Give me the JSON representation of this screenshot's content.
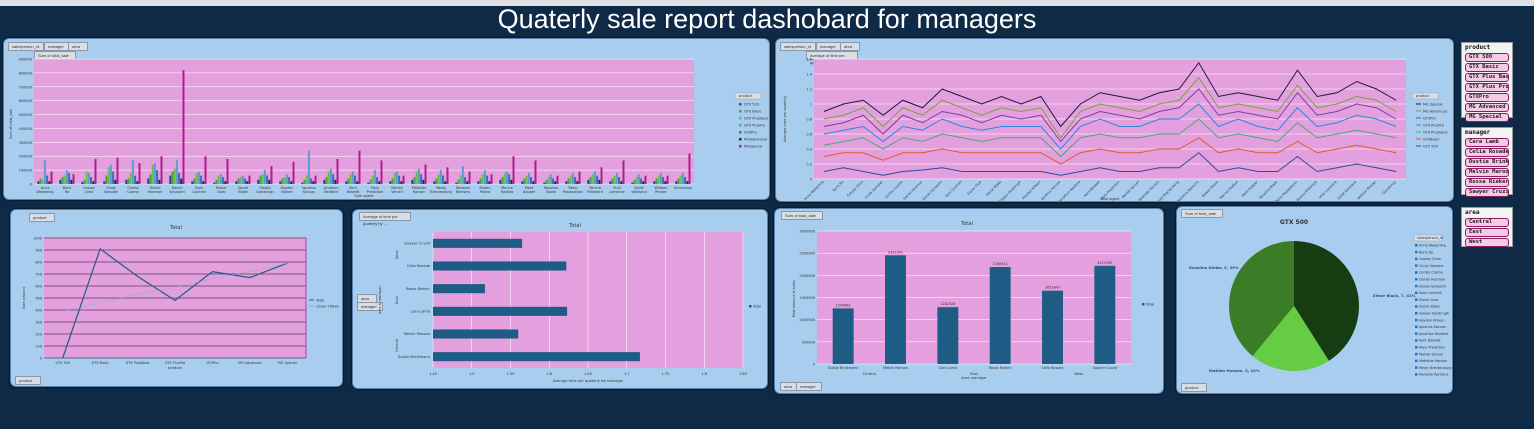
{
  "page_title": "Quaterly sale report dashobard for managers",
  "filters": {
    "salesperson": "salesperson_rd",
    "manager": "manager",
    "area": "area",
    "product": "product",
    "sum_total_sale": "Sum of total_sale",
    "avg_time": "Average of time per quaterly by ...",
    "sum_pie": "Sum of total_sale"
  },
  "slicers": {
    "product": {
      "title": "product",
      "items": [
        "GTX 500",
        "GTX Basic",
        "GTX Plus Basic",
        "GTX Plus Pro",
        "GTXPro",
        "MG Advanced",
        "MG Special"
      ]
    },
    "manager": {
      "title": "manager",
      "items": [
        "Cara Lamb",
        "Celia Rosade",
        "Dustie Brinkm...",
        "Melvin Maroon",
        "Rossa Riekerl",
        "Sawyer Cruzid"
      ]
    },
    "area": {
      "title": "area",
      "items": [
        "Central",
        "East",
        "West"
      ]
    }
  },
  "chart_data": [
    {
      "id": "chart1",
      "type": "bar",
      "title": "",
      "xlabel": "Sale agent",
      "ylabel": "Sum of total_sale",
      "ylim": [
        0,
        900000
      ],
      "yticks": [
        "0",
        "100000",
        "200000",
        "300000",
        "400000",
        "500000",
        "600000",
        "700000",
        "800000",
        "900000"
      ],
      "legend_title": "product",
      "categories": [
        "Anna Weberling",
        "Boris Ra",
        "Cassey Cima",
        "Cindy Sampler",
        "Corliss Cosme",
        "Daniel Hoeman",
        "Daniel Schaachi",
        "Dom Cockrell",
        "Eloise Clow",
        "Darrel Blake",
        "Gladys Golsbrugh",
        "Hayden Killeen",
        "Ignatius Kacvas",
        "Jonathan Bedford",
        "Kent Blewett",
        "Mary Prediction",
        "Mariah Vercell",
        "Mathilde Hanson",
        "Mealy Breckenburg",
        "Nanaine Ramsins",
        "Rowen Paseo",
        "Marina Hadlow",
        "Meet Dapper",
        "Rosalina Blade",
        "Retro Pepapolysis",
        "Verena Pilliehard",
        "Vicki Lamence",
        "Violet Wickland",
        "Willison Pender",
        "Danelonay"
      ],
      "series": [
        {
          "name": "GTX 500",
          "color": "#1f4e79",
          "values": [
            20000,
            30000,
            15000,
            20000,
            30000,
            40000,
            60000,
            20000,
            10000,
            20000,
            30000,
            20000,
            10000,
            30000,
            20000,
            10000,
            20000,
            30000,
            20000,
            10000,
            20000,
            30000,
            20000,
            10000,
            20000,
            30000,
            20000,
            10000,
            20000,
            20000
          ]
        },
        {
          "name": "GTX Basic",
          "color": "#4e9b4e",
          "values": [
            40000,
            50000,
            30000,
            60000,
            40000,
            70000,
            90000,
            40000,
            30000,
            40000,
            60000,
            40000,
            30000,
            50000,
            40000,
            30000,
            40000,
            50000,
            40000,
            30000,
            40000,
            50000,
            40000,
            30000,
            40000,
            50000,
            40000,
            30000,
            40000,
            40000
          ]
        },
        {
          "name": "GTX PlusBasic",
          "color": "#6fbf3f",
          "values": [
            30000,
            60000,
            90000,
            120000,
            80000,
            140000,
            110000,
            80000,
            60000,
            50000,
            70000,
            50000,
            60000,
            90000,
            70000,
            60000,
            80000,
            90000,
            70000,
            60000,
            70000,
            80000,
            60000,
            50000,
            60000,
            70000,
            60000,
            50000,
            60000,
            60000
          ]
        },
        {
          "name": "GTX PlusPro",
          "color": "#5b9bd5",
          "values": [
            170000,
            100000,
            80000,
            140000,
            170000,
            150000,
            170000,
            90000,
            70000,
            60000,
            100000,
            70000,
            240000,
            110000,
            90000,
            100000,
            90000,
            110000,
            100000,
            130000,
            100000,
            90000,
            80000,
            70000,
            80000,
            90000,
            80000,
            70000,
            80000,
            80000
          ]
        },
        {
          "name": "GTXPro",
          "color": "#2e75b6",
          "values": [
            60000,
            80000,
            50000,
            90000,
            60000,
            100000,
            80000,
            60000,
            50000,
            40000,
            60000,
            50000,
            40000,
            70000,
            60000,
            50000,
            60000,
            70000,
            60000,
            50000,
            60000,
            70000,
            50000,
            40000,
            50000,
            60000,
            50000,
            40000,
            50000,
            50000
          ]
        },
        {
          "name": "MGAdvanced",
          "color": "#1c2b5a",
          "values": [
            20000,
            30000,
            20000,
            30000,
            20000,
            30000,
            40000,
            20000,
            20000,
            20000,
            30000,
            20000,
            20000,
            30000,
            20000,
            20000,
            20000,
            30000,
            20000,
            20000,
            20000,
            30000,
            20000,
            20000,
            20000,
            30000,
            20000,
            20000,
            20000,
            20000
          ]
        },
        {
          "name": "MGSpecial",
          "color": "#b01b8e",
          "values": [
            90000,
            70000,
            180000,
            190000,
            150000,
            200000,
            820000,
            200000,
            180000,
            60000,
            130000,
            160000,
            60000,
            180000,
            240000,
            170000,
            60000,
            140000,
            120000,
            90000,
            70000,
            200000,
            170000,
            60000,
            90000,
            120000,
            170000,
            60000,
            60000,
            220000
          ]
        }
      ]
    },
    {
      "id": "chart2",
      "type": "line",
      "title": "",
      "xlabel": "Sale agent",
      "ylabel": "Average time per quaterly",
      "ylim": [
        0,
        1.6
      ],
      "yticks": [
        "0",
        "0.2",
        "0.4",
        "0.6",
        "0.8",
        "1",
        "1.2",
        "1.4",
        "1.6"
      ],
      "legend_title": "product",
      "categories": [
        "Anna Weberling",
        "Boris Ra",
        "Cassey Cima",
        "Cindy Sampler",
        "Corliss Cosme",
        "Daniel Hoeman",
        "Daniel Schaachi",
        "Dom Cockrell",
        "Eloise Clow",
        "Darrel Blake",
        "Gladys Golsbrugh",
        "Hayden Killeen",
        "Ignatius Kacvas",
        "Jonathan Bedford",
        "Kent Blewett",
        "Mary Prediction",
        "Mariah Vercell",
        "Mathilde Hanson",
        "Mealy Breckenburg",
        "Nanaine Ramsins",
        "Rowen Paseo",
        "Marina Hadlow",
        "Meet Dapper",
        "Rosalina Blade",
        "Retro Pepapolysis",
        "Verena Pilliehard",
        "Vicki Lamence",
        "Violet Wickland",
        "Willison Pender",
        "Danelonay"
      ],
      "series": [
        {
          "name": "MG Special",
          "color": "#1c1c3c",
          "values": [
            0.9,
            1.0,
            1.05,
            0.85,
            1.05,
            0.95,
            1.2,
            1.1,
            1.0,
            1.1,
            1.0,
            1.1,
            0.7,
            1.0,
            1.15,
            1.1,
            1.05,
            1.15,
            1.2,
            1.55,
            1.1,
            1.15,
            1.1,
            1.05,
            1.45,
            1.1,
            1.15,
            1.3,
            1.2,
            1.05
          ]
        },
        {
          "name": "MG Advanced",
          "color": "#7aa23c",
          "values": [
            0.8,
            0.85,
            0.95,
            0.7,
            0.95,
            0.85,
            1.05,
            0.95,
            0.85,
            0.95,
            0.9,
            0.95,
            0.55,
            0.9,
            1.0,
            0.95,
            0.9,
            1.0,
            1.05,
            1.35,
            0.95,
            1.0,
            0.95,
            0.9,
            1.25,
            0.95,
            1.0,
            1.1,
            1.05,
            0.9
          ]
        },
        {
          "name": "GTXPro",
          "color": "#7b3fa0",
          "values": [
            0.7,
            0.75,
            0.85,
            0.6,
            0.85,
            0.75,
            0.9,
            0.85,
            0.75,
            0.85,
            0.8,
            0.85,
            0.5,
            0.8,
            0.9,
            0.85,
            0.8,
            0.9,
            0.95,
            1.2,
            0.85,
            0.9,
            0.85,
            0.8,
            1.15,
            0.85,
            0.9,
            1.0,
            0.95,
            0.8
          ]
        },
        {
          "name": "GTX PlusPro",
          "color": "#2a88d8",
          "values": [
            0.6,
            0.65,
            0.7,
            0.5,
            0.7,
            0.65,
            0.8,
            0.7,
            0.65,
            0.7,
            0.7,
            0.7,
            0.4,
            0.7,
            0.8,
            0.7,
            0.7,
            0.8,
            0.8,
            1.0,
            0.7,
            0.8,
            0.7,
            0.65,
            0.95,
            0.7,
            0.75,
            0.85,
            0.8,
            0.7
          ]
        },
        {
          "name": "GTX PlusBasic",
          "color": "#4aa87a",
          "values": [
            0.45,
            0.5,
            0.55,
            0.4,
            0.55,
            0.5,
            0.6,
            0.55,
            0.5,
            0.55,
            0.55,
            0.55,
            0.3,
            0.55,
            0.6,
            0.55,
            0.55,
            0.6,
            0.6,
            0.8,
            0.55,
            0.6,
            0.55,
            0.5,
            0.75,
            0.55,
            0.6,
            0.65,
            0.6,
            0.55
          ]
        },
        {
          "name": "GTXBasic",
          "color": "#e25a2b",
          "values": [
            0.3,
            0.35,
            0.35,
            0.25,
            0.35,
            0.35,
            0.4,
            0.35,
            0.35,
            0.35,
            0.35,
            0.35,
            0.2,
            0.35,
            0.4,
            0.35,
            0.35,
            0.4,
            0.4,
            0.55,
            0.35,
            0.4,
            0.35,
            0.35,
            0.5,
            0.35,
            0.4,
            0.45,
            0.4,
            0.35
          ]
        },
        {
          "name": "GTX 500",
          "color": "#2b4b9a",
          "values": [
            0.1,
            0.15,
            0.1,
            0.05,
            0.1,
            0.12,
            0.15,
            0.1,
            0.1,
            0.1,
            0.1,
            0.1,
            0.05,
            0.1,
            0.15,
            0.1,
            0.1,
            0.15,
            0.15,
            0.35,
            0.1,
            0.15,
            0.1,
            0.1,
            0.3,
            0.1,
            0.15,
            0.2,
            0.15,
            0.1
          ]
        }
      ]
    },
    {
      "id": "chart3",
      "type": "line",
      "title": "Total",
      "xlabel": "product",
      "ylabel": "Sale amount",
      "ylim": [
        0,
        1000
      ],
      "yticks": [
        "0",
        "100",
        "200",
        "300",
        "400",
        "500",
        "600",
        "700",
        "800",
        "900",
        "1000"
      ],
      "categories": [
        "GTX 500",
        "GTX Basic",
        "GTX PlusBasic",
        "GTX PlusPro",
        "GTXPro",
        "MG Advanced",
        "MG Special"
      ],
      "series": [
        {
          "name": "Total",
          "color": "#1e5c85",
          "values": [
            0,
            910,
            680,
            480,
            720,
            670,
            790
          ]
        },
        {
          "name": "Linear (Total)",
          "color": "#7ab0d0",
          "values": [
            390,
            460,
            530,
            590,
            660,
            720,
            790
          ]
        }
      ]
    },
    {
      "id": "chart4",
      "type": "bar",
      "title": "Total",
      "xlabel": "Average time per quaterly for manager",
      "ylabel": "area & manager",
      "xlim": [
        1.45,
        1.85
      ],
      "xticks": [
        "1.45",
        "1.5",
        "1.55",
        "1.6",
        "1.65",
        "1.7",
        "1.75",
        "1.8",
        "1.85"
      ],
      "groups": [
        "West",
        "East",
        "Central"
      ],
      "categories": [
        "Sawyer Cruzid",
        "Celia Rosade",
        "Rossa Riekerl",
        "Cara Lamb",
        "Melvin Maroon",
        "Dustie Brinkmann"
      ],
      "cat_groups": [
        "West",
        "West",
        "East",
        "East",
        "Central",
        "Central"
      ],
      "series": [
        {
          "name": "Total",
          "color": "#1e5c85",
          "values": [
            1.565,
            1.622,
            1.517,
            1.623,
            1.56,
            1.717
          ]
        }
      ]
    },
    {
      "id": "chart5",
      "type": "bar",
      "title": "Total",
      "xlabel": "Area manager",
      "ylabel": "Total amount of sales",
      "ylim": [
        0,
        3000000
      ],
      "yticks": [
        "0",
        "500000",
        "1000000",
        "1500000",
        "2000000",
        "2500000",
        "3000000"
      ],
      "categories": [
        "Dustie Brinkmann",
        "Melvin Maroon",
        "Cara Lamb",
        "Rossa Riekerl",
        "Celia Rosade",
        "Sawyer Cruzid"
      ],
      "groups": [
        "Central",
        "East",
        "West"
      ],
      "series": [
        {
          "name": "Total",
          "color": "#1e5c85",
          "values": [
            1254682,
            2451901,
            1282028,
            2186541,
            1653847,
            2213769
          ],
          "labels": [
            "1254682",
            "2451901",
            "1282028",
            "2186541",
            "1653847",
            "2213769"
          ]
        }
      ]
    },
    {
      "id": "chart6",
      "type": "pie",
      "title": "GTX 500",
      "legend_title": "salesperson_rd",
      "categories": [
        "Elmer Black",
        "Matilda Hanson",
        "Rosalina Dieter"
      ],
      "slices": [
        {
          "label": "Elmer Black, 7, 41%",
          "name": "Elmer Black",
          "value": 41,
          "color": "#163d12"
        },
        {
          "label": "Matilda Hanson, 3, 20%",
          "name": "Matilda Hanson",
          "value": 20,
          "color": "#66cc44"
        },
        {
          "label": "Rosalina Dieter, 5, 39%",
          "name": "Rosalina Dieter",
          "value": 39,
          "color": "#3a7d26"
        }
      ],
      "legend": [
        "Anna Weberling",
        "Boris Ra",
        "Cassey Cima",
        "Cindy Sampler",
        "Corliss Cosme",
        "Daniel Hoeman",
        "Daniel Schaachi",
        "Dom Cockrell",
        "Eloise Clow",
        "Darrel Blake",
        "Gladys Golsbrugh",
        "Hayden Killeen",
        "Ignatius Kacvas",
        "Jonathan Bedford",
        "Kent Blewett",
        "Mary Prediction",
        "Mariah Vercell",
        "Mathilde Hanson",
        "Mealy Breckenburg",
        "Nanaine Ramsins"
      ]
    }
  ]
}
